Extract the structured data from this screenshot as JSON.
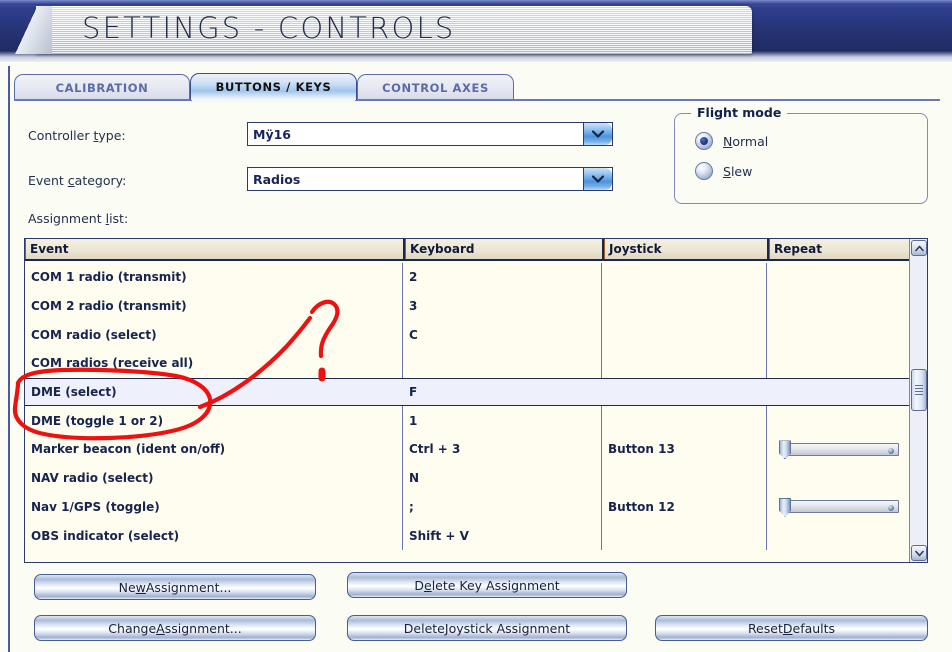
{
  "window": {
    "title": "SETTINGS - CONTROLS"
  },
  "tabs": [
    {
      "label": "CALIBRATION",
      "active": false
    },
    {
      "label": "BUTTONS / KEYS",
      "active": true
    },
    {
      "label": "CONTROL AXES",
      "active": false
    }
  ],
  "fields": {
    "controller_type": {
      "label_pre": "Controller ",
      "label_accel": "t",
      "label_post": "ype:",
      "value": "Mÿ16"
    },
    "event_category": {
      "label_pre": "Event ",
      "label_accel": "c",
      "label_post": "ategory:",
      "value": "Radios"
    },
    "assignment_list_label_pre": "Assignment ",
    "assignment_list_label_accel": "l",
    "assignment_list_label_post": "ist:"
  },
  "flight_mode": {
    "title": "Flight mode",
    "options": [
      {
        "label_pre": "",
        "label_accel": "N",
        "label_post": "ormal",
        "selected": true
      },
      {
        "label_pre": "",
        "label_accel": "S",
        "label_post": "lew",
        "selected": false
      }
    ]
  },
  "table": {
    "columns": [
      "Event",
      "Keyboard",
      "Joystick",
      "Repeat"
    ],
    "rows": [
      {
        "event": "COM 1 radio (transmit)",
        "keyboard": "2",
        "joystick": "",
        "repeat": false,
        "selected": false
      },
      {
        "event": "COM 2 radio (transmit)",
        "keyboard": "3",
        "joystick": "",
        "repeat": false,
        "selected": false
      },
      {
        "event": "COM radio (select)",
        "keyboard": "C",
        "joystick": "",
        "repeat": false,
        "selected": false
      },
      {
        "event": "COM radios (receive all)",
        "keyboard": "",
        "joystick": "",
        "repeat": false,
        "selected": false
      },
      {
        "event": "DME (select)",
        "keyboard": "F",
        "joystick": "",
        "repeat": false,
        "selected": true
      },
      {
        "event": "DME (toggle 1 or 2)",
        "keyboard": "1",
        "joystick": "",
        "repeat": false,
        "selected": false
      },
      {
        "event": "Marker beacon (ident on/off)",
        "keyboard": "Ctrl + 3",
        "joystick": "Button 13",
        "repeat": true,
        "selected": false
      },
      {
        "event": "NAV radio (select)",
        "keyboard": "N",
        "joystick": "",
        "repeat": false,
        "selected": false
      },
      {
        "event": "Nav 1/GPS (toggle)",
        "keyboard": ";",
        "joystick": "Button 12",
        "repeat": true,
        "selected": false
      },
      {
        "event": "OBS indicator (select)",
        "keyboard": "Shift + V",
        "joystick": "",
        "repeat": false,
        "selected": false
      }
    ]
  },
  "buttons": [
    {
      "pre": "Ne",
      "accel": "w",
      "post": " Assignment..."
    },
    {
      "pre": "D",
      "accel": "e",
      "post": "lete Key Assignment"
    },
    {
      "pre": "Change ",
      "accel": "A",
      "post": "ssignment..."
    },
    {
      "pre": "Delete ",
      "accel": "J",
      "post": "oystick Assignment"
    },
    {
      "pre": "Reset ",
      "accel": "D",
      "post": "efaults"
    }
  ],
  "annotation": {
    "color": "#ee1111",
    "marks": [
      "ellipse-around-dme-rows",
      "pointer-curve",
      "question-mark"
    ]
  },
  "colors": {
    "banner_blue": "#273577",
    "accent_navy": "#16244e",
    "list_bg": "#fffdef",
    "selected_row": "#eef0fc",
    "annotation_red": "#ee1111"
  }
}
